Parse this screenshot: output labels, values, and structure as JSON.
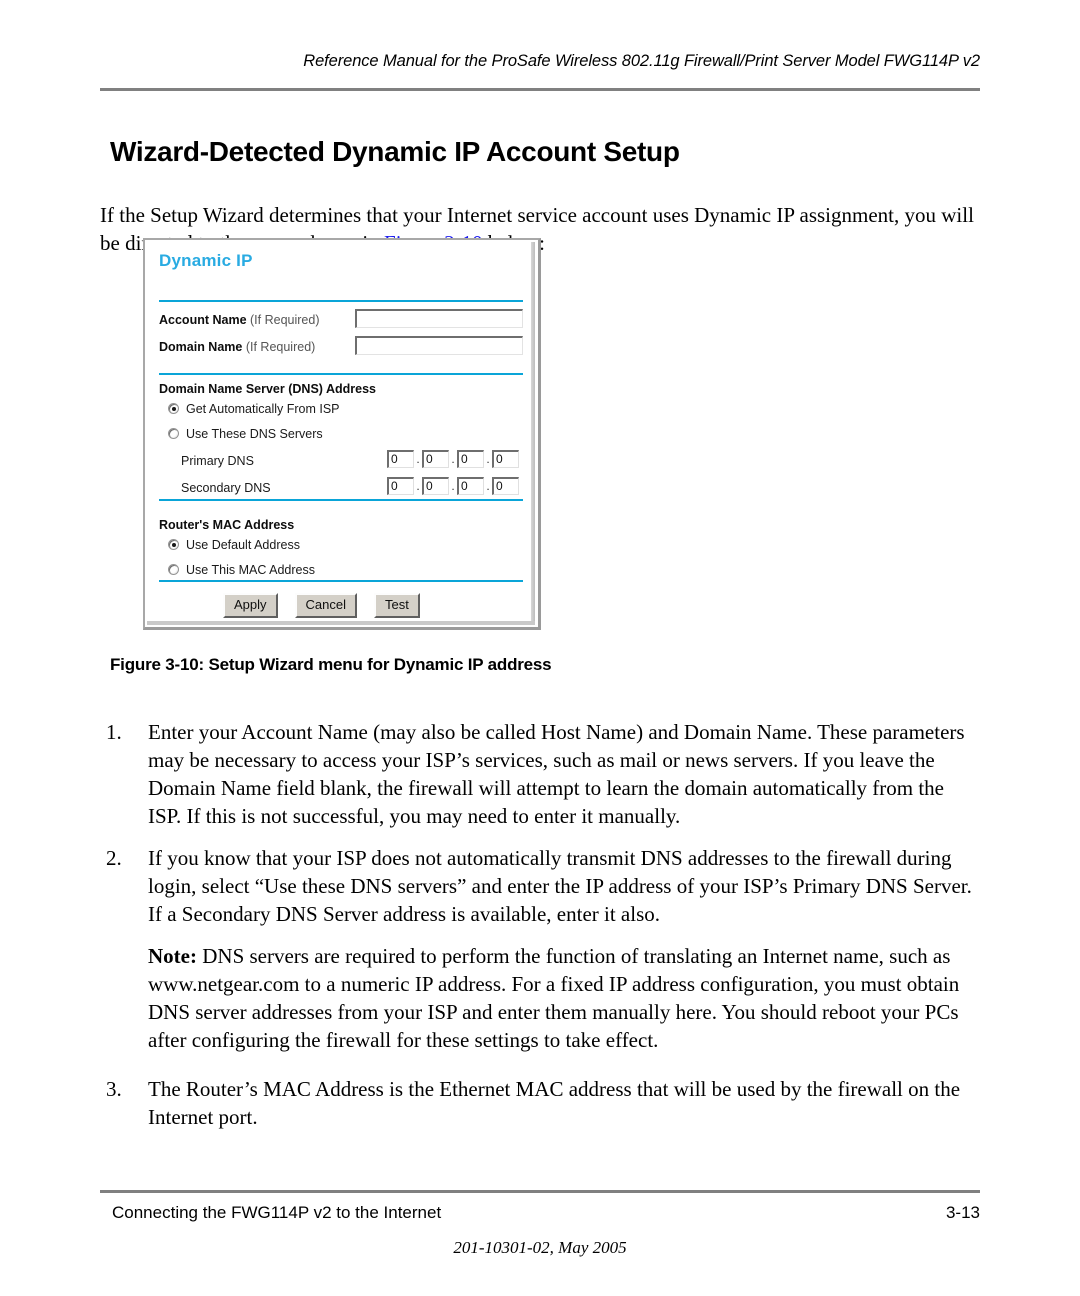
{
  "header": {
    "running_head": "Reference Manual for the ProSafe Wireless 802.11g  Firewall/Print Server Model FWG114P v2"
  },
  "page_title": "Wizard-Detected Dynamic IP Account Setup",
  "intro": {
    "before_link": "If the Setup Wizard determines that your Internet service account uses Dynamic IP assignment, you will be directed to the menu shown in ",
    "link_text": "Figure 3-10",
    "after_link": " below:"
  },
  "figure": {
    "caption": "Figure 3-10: Setup Wizard menu for Dynamic IP address",
    "gui": {
      "title": "Dynamic IP",
      "accent_color": "#29abe2",
      "divider_color": "#0aa5d8",
      "account_name_label": "Account Name",
      "account_name_optional": "(If Required)",
      "account_name_value": "",
      "domain_name_label": "Domain Name",
      "domain_name_optional": "(If Required)",
      "domain_name_value": "",
      "dns_section_label": "Domain Name Server (DNS) Address",
      "dns_option_auto": "Get Automatically From ISP",
      "dns_option_manual": "Use These DNS Servers",
      "dns_selected": "Get Automatically From ISP",
      "primary_dns_label": "Primary DNS",
      "secondary_dns_label": "Secondary DNS",
      "primary_dns_octets": [
        "0",
        "0",
        "0",
        "0"
      ],
      "secondary_dns_octets": [
        "0",
        "0",
        "0",
        "0"
      ],
      "octet_separator": ".",
      "mac_section_label": "Router's MAC Address",
      "mac_option_default": "Use Default Address",
      "mac_option_this": "Use This MAC Address",
      "mac_selected": "Use Default Address",
      "buttons": [
        "Apply",
        "Cancel",
        "Test"
      ]
    }
  },
  "steps": [
    {
      "number": "1.",
      "text": "Enter your Account Name (may also be called Host Name) and Domain Name. These parameters may be necessary to access your ISP’s services, such as mail or news servers. If you leave the Domain Name field blank, the firewall will attempt to learn the domain automatically from the ISP. If this is not successful, you may need to enter it manually."
    },
    {
      "number": "2.",
      "text": "If you know that your ISP does not automatically transmit DNS addresses to the firewall during login, select “Use these DNS servers” and enter the IP address of your ISP’s Primary DNS Server. If a Secondary DNS Server address is available, enter it also."
    },
    {
      "number": "3.",
      "text": "The Router’s MAC Address is the Ethernet MAC address that will be used by the firewall on the Internet port."
    }
  ],
  "note": {
    "lead": "Note:",
    "text": " DNS servers are required to perform the function of translating an Internet name, such as www.netgear.com to a numeric IP address. For a fixed IP address configuration, you must obtain DNS server addresses from your ISP and enter them manually here. You should reboot your PCs after configuring the firewall for these settings to take effect."
  },
  "footer": {
    "left": "Connecting the FWG114P v2 to the Internet",
    "page_number": "3-13",
    "center": "201-10301-02, May 2005"
  }
}
